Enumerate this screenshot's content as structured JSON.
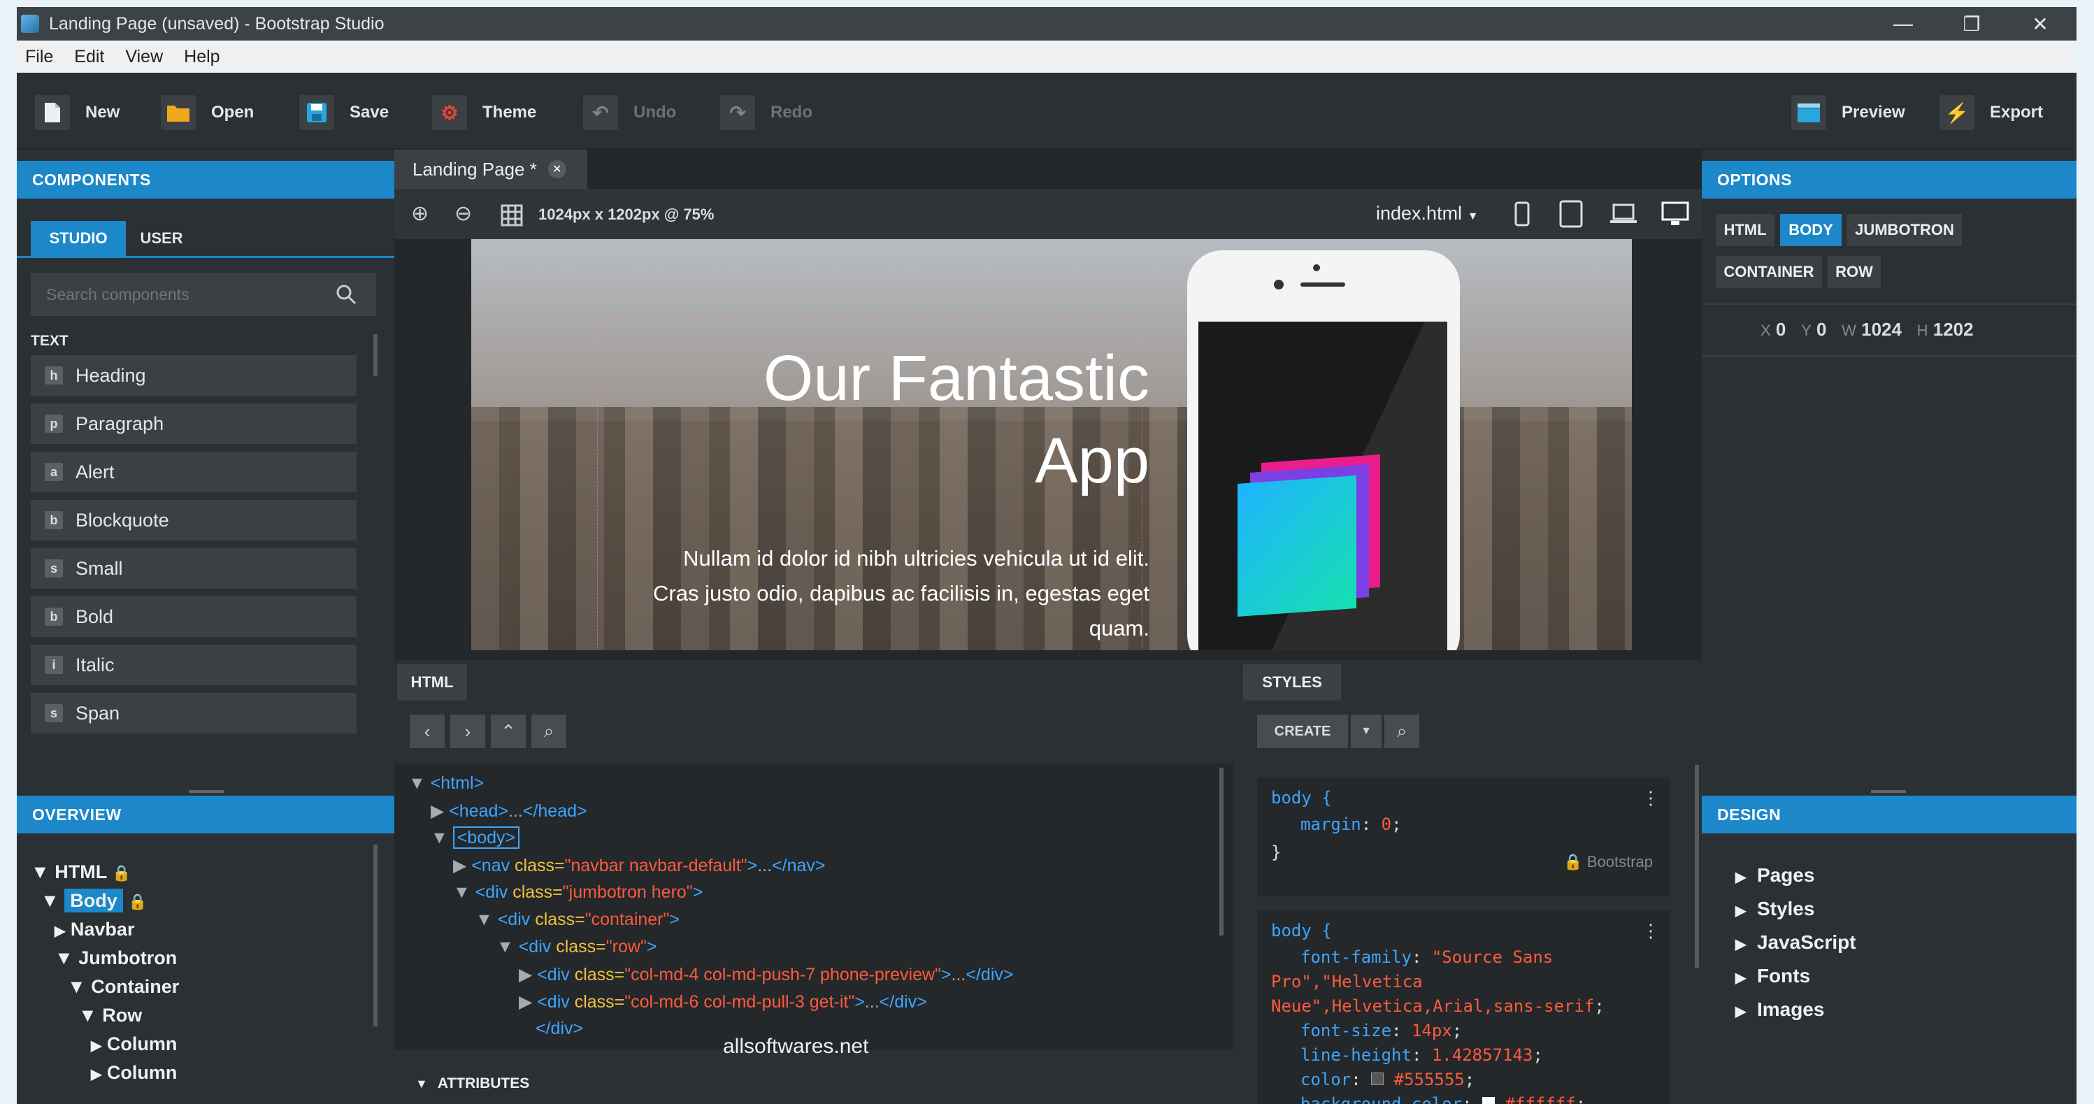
{
  "window": {
    "title": "Landing Page (unsaved) - Bootstrap Studio",
    "controls": {
      "minimize": "—",
      "restore": "❐",
      "close": "✕"
    }
  },
  "menu": [
    "File",
    "Edit",
    "View",
    "Help"
  ],
  "toolbar": {
    "new": "New",
    "open": "Open",
    "save": "Save",
    "theme": "Theme",
    "undo": "Undo",
    "redo": "Redo",
    "preview": "Preview",
    "export": "Export"
  },
  "components": {
    "header": "COMPONENTS",
    "tabs": [
      "STUDIO",
      "USER"
    ],
    "search_placeholder": "Search components",
    "section": "TEXT",
    "items": [
      {
        "badge": "h",
        "label": "Heading"
      },
      {
        "badge": "p",
        "label": "Paragraph"
      },
      {
        "badge": "a",
        "label": "Alert"
      },
      {
        "badge": "b",
        "label": "Blockquote"
      },
      {
        "badge": "s",
        "label": "Small"
      },
      {
        "badge": "b",
        "label": "Bold"
      },
      {
        "badge": "i",
        "label": "Italic"
      },
      {
        "badge": "s",
        "label": "Span"
      }
    ]
  },
  "overview": {
    "header": "OVERVIEW",
    "nodes": [
      {
        "arrow": "▼",
        "label": "HTML",
        "lock": true
      },
      {
        "arrow": "▼",
        "label": "Body",
        "lock": true
      },
      {
        "arrow": "▶",
        "label": "Navbar"
      },
      {
        "arrow": "▼",
        "label": "Jumbotron"
      },
      {
        "arrow": "▼",
        "label": "Container"
      },
      {
        "arrow": "▼",
        "label": "Row"
      },
      {
        "arrow": "▶",
        "label": "Column"
      },
      {
        "arrow": "▶",
        "label": "Column"
      }
    ]
  },
  "editor": {
    "tab": "Landing Page *",
    "size_label": "1024px x 1202px @ 75%",
    "page_select": "index.html",
    "hero_title_1": "Our Fantastic",
    "hero_title_2": "App",
    "hero_text_1": "Nullam id dolor id nibh ultricies vehicula ut id elit.",
    "hero_text_2": "Cras justo odio, dapibus ac facilisis in, egestas eget",
    "hero_text_3": "quam."
  },
  "html_panel": {
    "header": "HTML",
    "attributes": "ATTRIBUTES",
    "lines": [
      {
        "arrow": "▼",
        "tag": "<html>"
      },
      {
        "arrow": "▶",
        "tag": "<head>",
        "rest": "...",
        "close": "</head>"
      },
      {
        "arrow": "▼",
        "tag": "<body>"
      },
      {
        "arrow": "▶",
        "open": "<nav ",
        "attr": "class=",
        "str": "\"navbar navbar-default\"",
        "end": ">",
        "rest": "...",
        "close": "</nav>"
      },
      {
        "arrow": "▼",
        "open": "<div ",
        "attr": "class=",
        "str": "\"jumbotron hero\"",
        "end": ">"
      },
      {
        "arrow": "▼",
        "open": "<div ",
        "attr": "class=",
        "str": "\"container\"",
        "end": ">"
      },
      {
        "arrow": "▼",
        "open": "<div ",
        "attr": "class=",
        "str": "\"row\"",
        "end": ">"
      },
      {
        "arrow": "▶",
        "open": "<div ",
        "attr": "class=",
        "str": "\"col-md-4 col-md-push-7 phone-preview\"",
        "end": ">",
        "rest": "...",
        "close": "</div>"
      },
      {
        "arrow": "▶",
        "open": "<div ",
        "attr": "class=",
        "str": "\"col-md-6 col-md-pull-3 get-it\"",
        "end": ">",
        "rest": "...",
        "close": "</div>"
      },
      {
        "arrow": "",
        "tag": "</div>"
      }
    ],
    "watermark": "allsoftwares.net"
  },
  "styles_panel": {
    "header": "STYLES",
    "create": "CREATE",
    "rule1": {
      "selector": "body {",
      "prop": "margin",
      "value": "0",
      "close": "}",
      "source": "Bootstrap"
    },
    "rule2": {
      "selector": "body {",
      "font_family_prop": "font-family",
      "font_family_val_1": "\"Source Sans",
      "font_family_val_2": "Pro\",\"Helvetica",
      "font_family_val_3": "Neue\",Helvetica,Arial,sans-serif",
      "font_size_prop": "font-size",
      "font_size_val": "14px",
      "line_height_prop": "line-height",
      "line_height_val": "1.42857143",
      "color_prop": "color",
      "color_val": "#555555",
      "bg_prop": "background-color",
      "bg_val": "#ffffff"
    }
  },
  "options": {
    "header": "OPTIONS",
    "tags": [
      "HTML",
      "BODY",
      "JUMBOTRON",
      "CONTAINER",
      "ROW"
    ],
    "x_label": "X",
    "x": "0",
    "y_label": "Y",
    "y": "0",
    "w_label": "W",
    "w": "1024",
    "h_label": "H",
    "h": "1202"
  },
  "design": {
    "header": "DESIGN",
    "items": [
      "Pages",
      "Styles",
      "JavaScript",
      "Fonts",
      "Images"
    ]
  }
}
